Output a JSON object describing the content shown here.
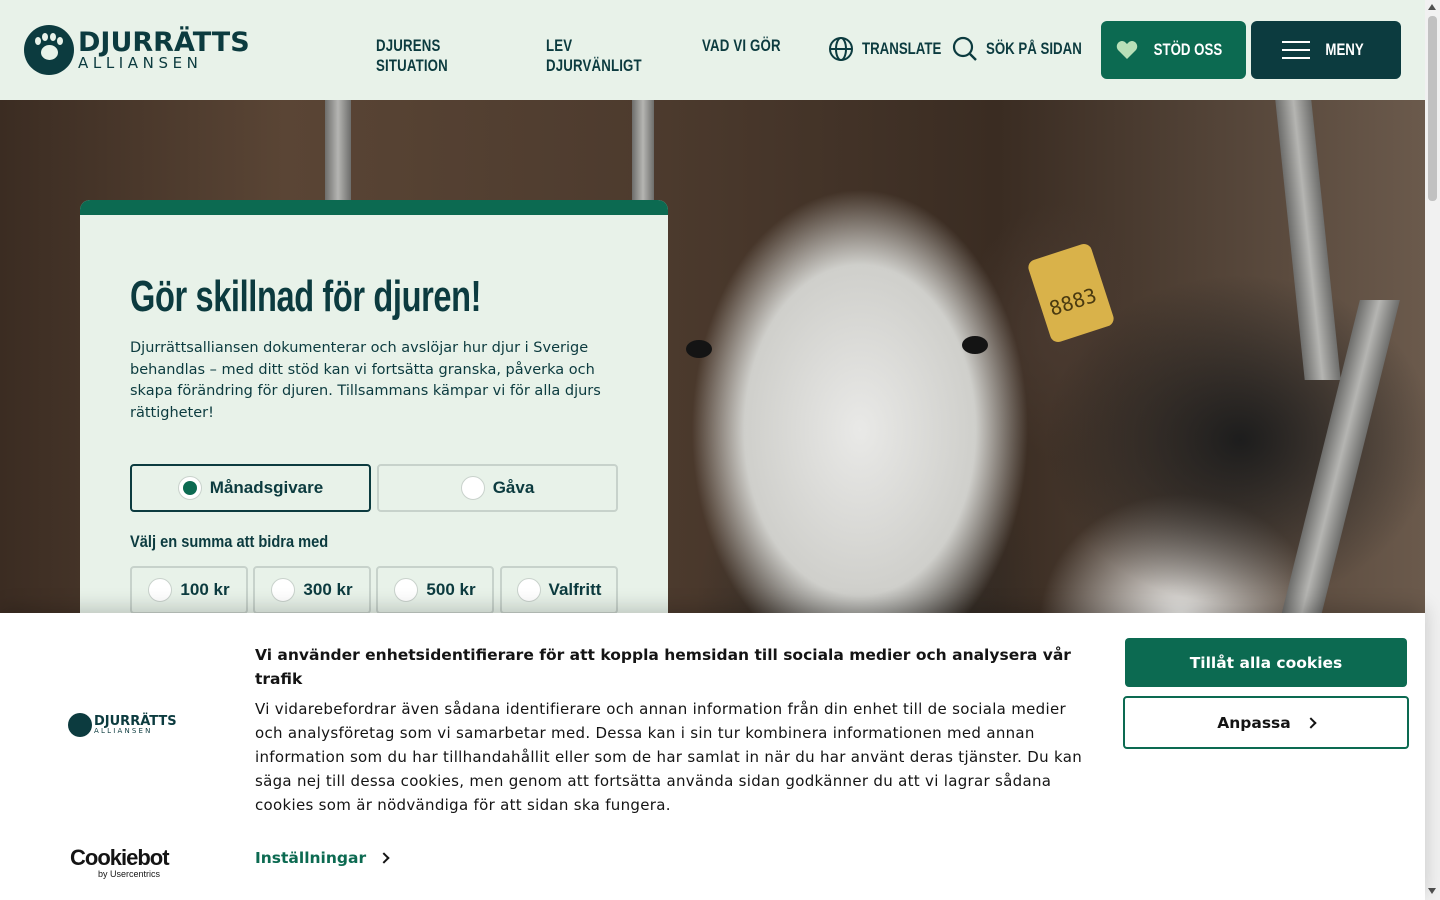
{
  "brand": {
    "line1": "DJURRÄTTS",
    "line2": "ALLIANSEN",
    "color_dark": "#0c3b3f",
    "color_green": "#0c6a51"
  },
  "nav": {
    "items": [
      {
        "label": "DJURENS SITUATION"
      },
      {
        "label": "LEV DJURVÄNLIGT"
      },
      {
        "label": "VAD VI GÖR"
      }
    ],
    "translate": "TRANSLATE",
    "search": "SÖK PÅ SIDAN",
    "support": "STÖD OSS",
    "menu": "MENY"
  },
  "hero": {
    "ear_tag": "8883"
  },
  "donation": {
    "title": "Gör skillnad för djuren!",
    "description": "Djurrättsalliansen dokumenterar och avslöjar hur djur i Sverige behandlas – med ditt stöd kan vi fortsätta granska, påverka och skapa förändring för djuren. Tillsammans kämpar vi för alla djurs rättigheter!",
    "types": [
      {
        "label": "Månadsgivare",
        "selected": true
      },
      {
        "label": "Gåva",
        "selected": false
      }
    ],
    "amount_label": "Välj en summa att bidra med",
    "amounts": [
      {
        "label": "100 kr"
      },
      {
        "label": "300 kr"
      },
      {
        "label": "500 kr"
      },
      {
        "label": "Valfritt"
      }
    ]
  },
  "cookie": {
    "logo_line1": "DJURRÄTTS",
    "logo_line2": "ALLIANSEN",
    "heading": "Vi använder enhetsidentifierare för att koppla hemsidan till sociala medier och analysera vår trafik",
    "body": "Vi vidarebefordrar även sådana identifierare och annan information från din enhet till de sociala medier och analysföretag som vi samarbetar med. Dessa kan i sin tur kombinera informationen med annan information som du har tillhandahållit eller som de har samlat in när du har använt deras tjänster. Du kan säga nej till dessa cookies, men genom att fortsätta använda sidan godkänner du att vi lagrar sådana cookies som är nödvändiga för att sidan ska fungera.",
    "settings": "Inställningar",
    "allow_all": "Tillåt alla cookies",
    "customize": "Anpassa",
    "provider": "Cookiebot",
    "provider_sub": "by Usercentrics"
  }
}
